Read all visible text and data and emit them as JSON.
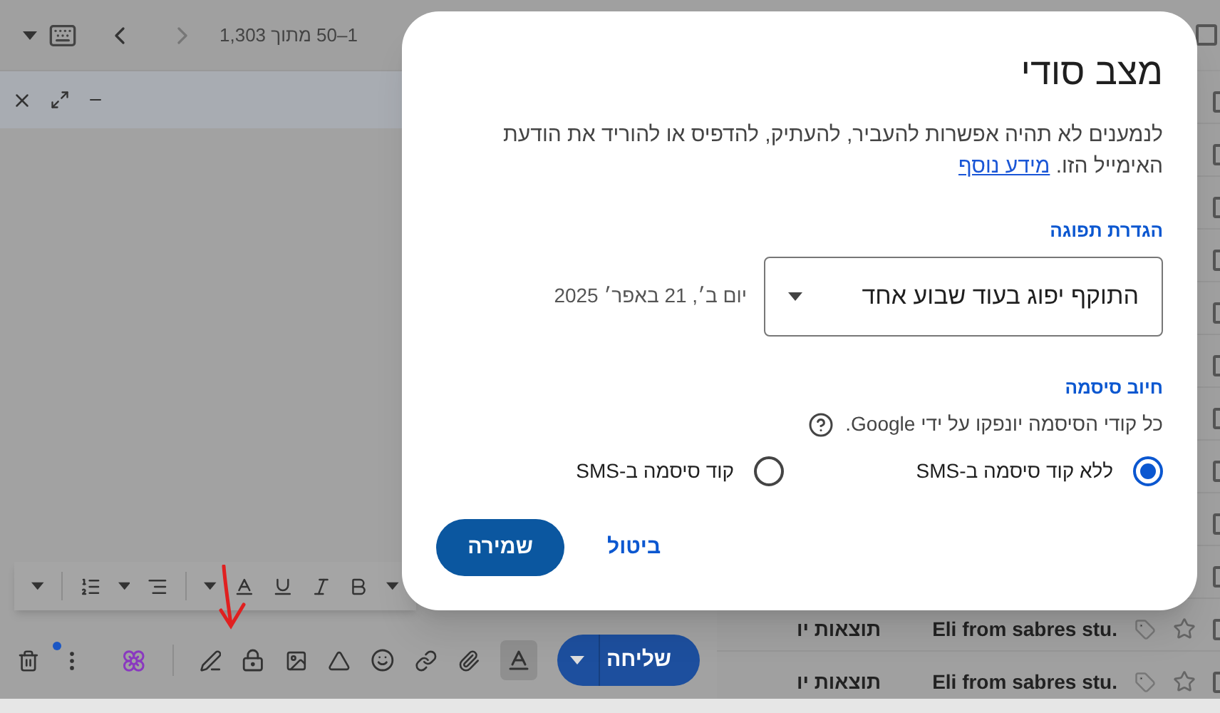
{
  "top_bar": {
    "pagination": "1–50 מתוך 1,303"
  },
  "compose": {
    "send_button": "שליחה",
    "formatting_open": true
  },
  "inbox": {
    "select_all_checked": false,
    "rows": [
      {
        "checked": false
      },
      {
        "checked": false
      },
      {
        "checked": false
      },
      {
        "checked": false
      },
      {
        "checked": false
      },
      {
        "checked": false
      },
      {
        "checked": false
      },
      {
        "checked": false
      },
      {
        "checked": false
      },
      {
        "checked": false
      },
      {
        "sender": "Eli from sabres stu.",
        "subject": "תוצאות יו",
        "checked": false
      },
      {
        "sender": "Eli from sabres stu.",
        "subject": "תוצאות יו",
        "checked": false
      }
    ]
  },
  "dialog": {
    "title": "מצב סודי",
    "description": "לנמענים לא תהיה אפשרות להעביר, להעתיק, להדפיס או להוריד את הודעת האימייל הזו.",
    "learn_more_link": "מידע נוסף",
    "expiry": {
      "label": "הגדרת תפוגה",
      "value": "התוקף יפוג בעוד שבוע אחד",
      "date": "יום ב׳, 21 באפר׳ 2025"
    },
    "password": {
      "label": "חיוב סיסמה",
      "note": "כל קודי הסיסמה יונפקו על ידי Google.",
      "options": [
        {
          "label": "ללא קוד סיסמה ב-SMS",
          "selected": true
        },
        {
          "label": "קוד סיסמה ב-SMS",
          "selected": false
        }
      ]
    },
    "buttons": {
      "cancel": "ביטול",
      "save": "שמירה"
    }
  }
}
